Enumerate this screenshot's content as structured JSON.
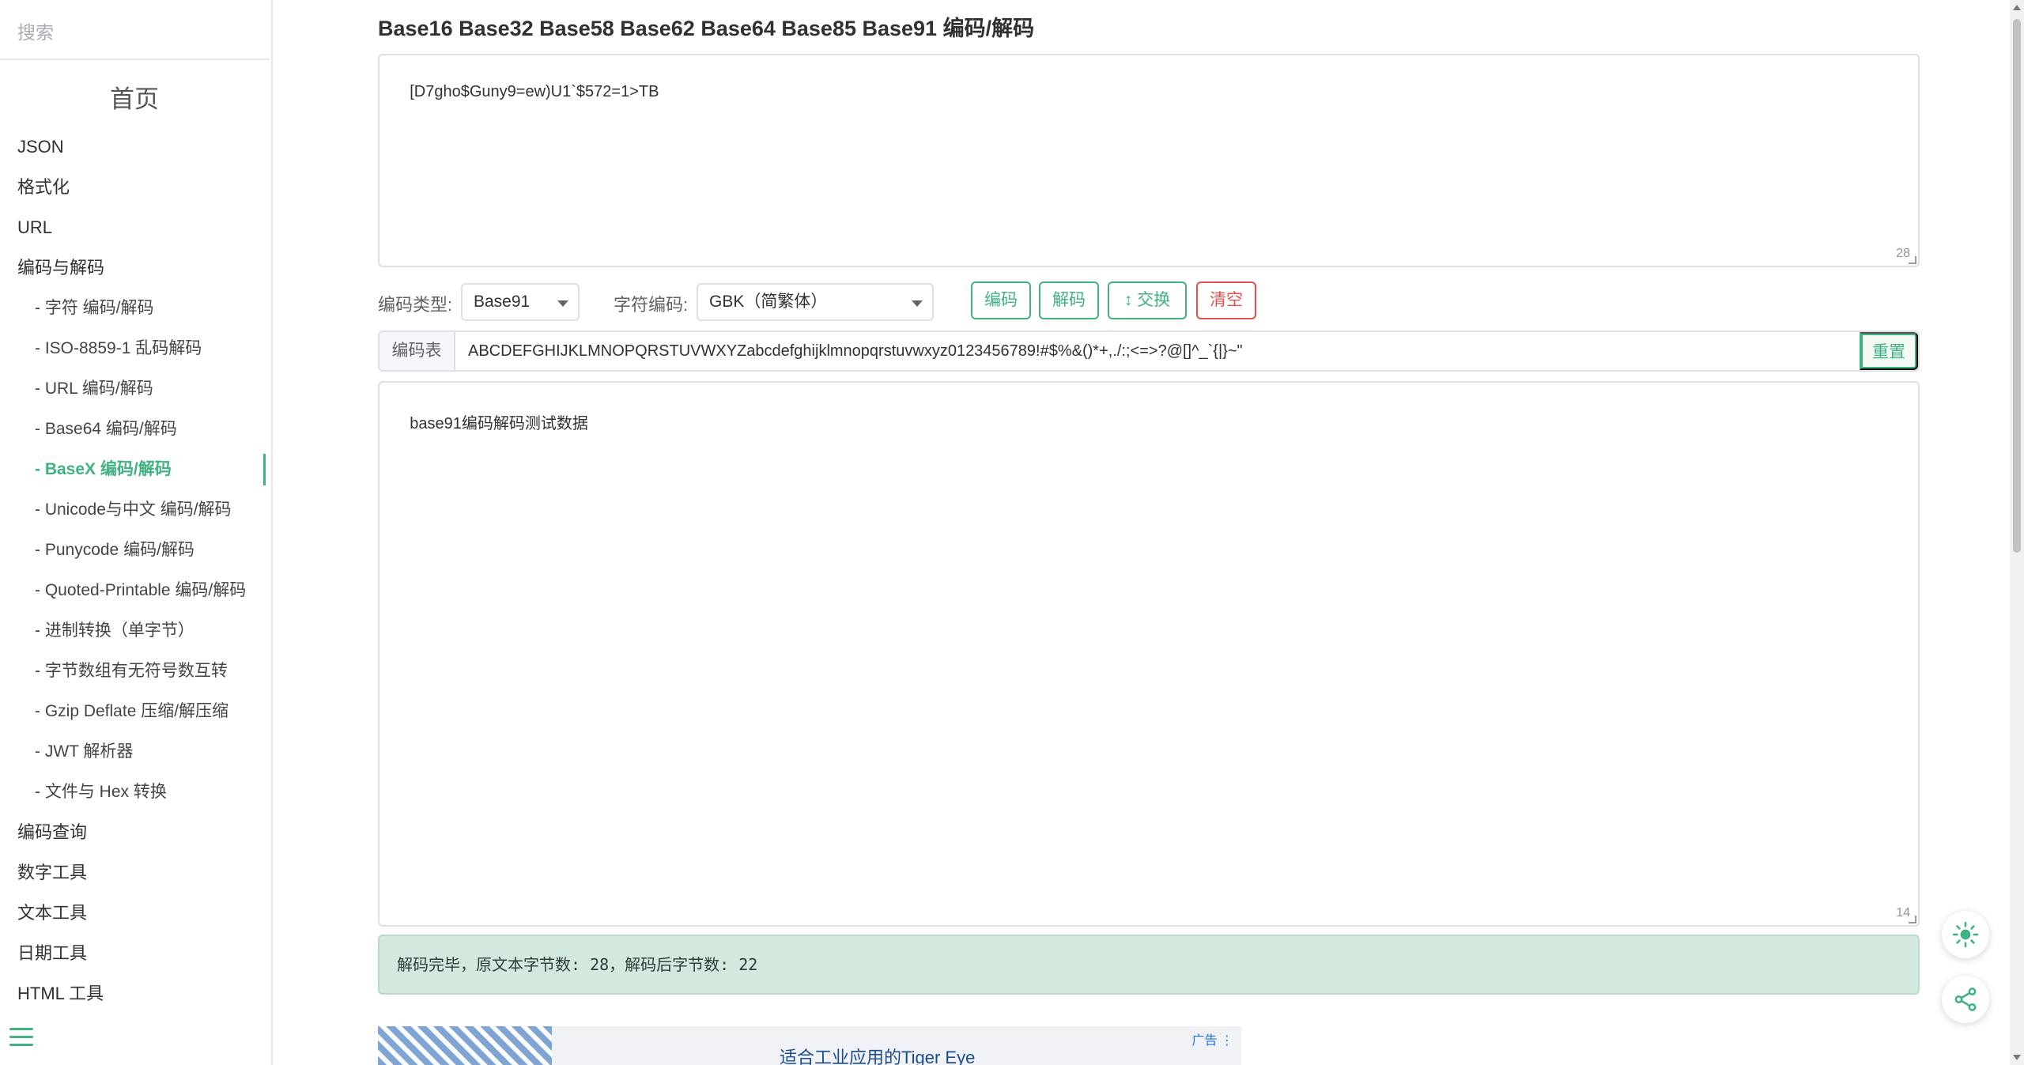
{
  "sidebar": {
    "search_placeholder": "搜索",
    "home": "首页",
    "items": [
      {
        "label": "JSON",
        "sub": false
      },
      {
        "label": "格式化",
        "sub": false
      },
      {
        "label": "URL",
        "sub": false
      },
      {
        "label": "编码与解码",
        "sub": false
      },
      {
        "label": "- 字符  编码/解码",
        "sub": true
      },
      {
        "label": "- ISO-8859-1 乱码解码",
        "sub": true
      },
      {
        "label": "- URL  编码/解码",
        "sub": true
      },
      {
        "label": "- Base64  编码/解码",
        "sub": true
      },
      {
        "label": "- BaseX  编码/解码",
        "sub": true,
        "active": true
      },
      {
        "label": "- Unicode与中文  编码/解码",
        "sub": true
      },
      {
        "label": "- Punycode  编码/解码",
        "sub": true
      },
      {
        "label": "- Quoted-Printable  编码/解码",
        "sub": true
      },
      {
        "label": "- 进制转换（单字节）",
        "sub": true
      },
      {
        "label": "- 字节数组有无符号数互转",
        "sub": true
      },
      {
        "label": "- Gzip Deflate 压缩/解压缩",
        "sub": true
      },
      {
        "label": "- JWT 解析器",
        "sub": true
      },
      {
        "label": "- 文件与 Hex 转换",
        "sub": true
      },
      {
        "label": "编码查询",
        "sub": false
      },
      {
        "label": "数字工具",
        "sub": false
      },
      {
        "label": "文本工具",
        "sub": false
      },
      {
        "label": "日期工具",
        "sub": false
      },
      {
        "label": "HTML 工具",
        "sub": false
      }
    ]
  },
  "main": {
    "title": "Base16 Base32 Base58 Base62 Base64 Base85 Base91 编码/解码",
    "input": {
      "value": "[D7gho$Guny9=ew)U1`$572=1>TB",
      "count": "28"
    },
    "controls": {
      "encode_type_label": "编码类型:",
      "encode_type_value": "Base91",
      "charset_label": "字符编码:",
      "charset_value": "GBK（简繁体）",
      "encode_btn": "编码",
      "decode_btn": "解码",
      "swap_btn": "↕ 交换",
      "clear_btn": "清空"
    },
    "table": {
      "label": "编码表",
      "value": "ABCDEFGHIJKLMNOPQRSTUVWXYZabcdefghijklmnopqrstuvwxyz0123456789!#$%&()*+,./:;<=>?@[]^_`{|}~\"",
      "reset_btn": "重置"
    },
    "output": {
      "value": "base91编码解码测试数据",
      "count": "14"
    },
    "result": "解码完毕，原文本字节数: 28，解码后字节数: 22",
    "ad": {
      "text": "适合工业应用的Tiger Eye",
      "badge": "广告 ⋮"
    }
  },
  "colors": {
    "accent": "#3fb27f",
    "danger": "#e05151",
    "result_bg": "#d3e9dd"
  }
}
